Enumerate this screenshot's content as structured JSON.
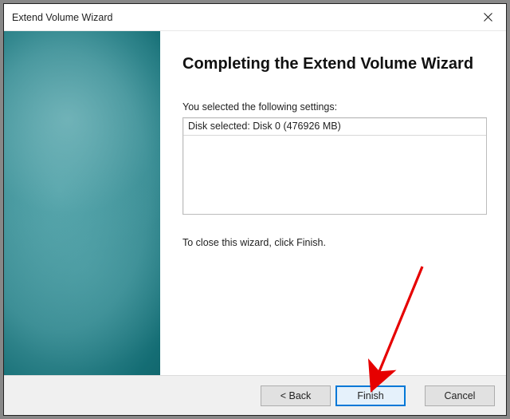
{
  "window": {
    "title": "Extend Volume Wizard"
  },
  "main": {
    "heading": "Completing the Extend Volume Wizard",
    "settings_label": "You selected the following settings:",
    "settings_rows": {
      "row0": "Disk selected: Disk 0 (476926 MB)"
    },
    "close_text": "To close this wizard, click Finish."
  },
  "buttons": {
    "back": "< Back",
    "finish": "Finish",
    "cancel": "Cancel"
  }
}
